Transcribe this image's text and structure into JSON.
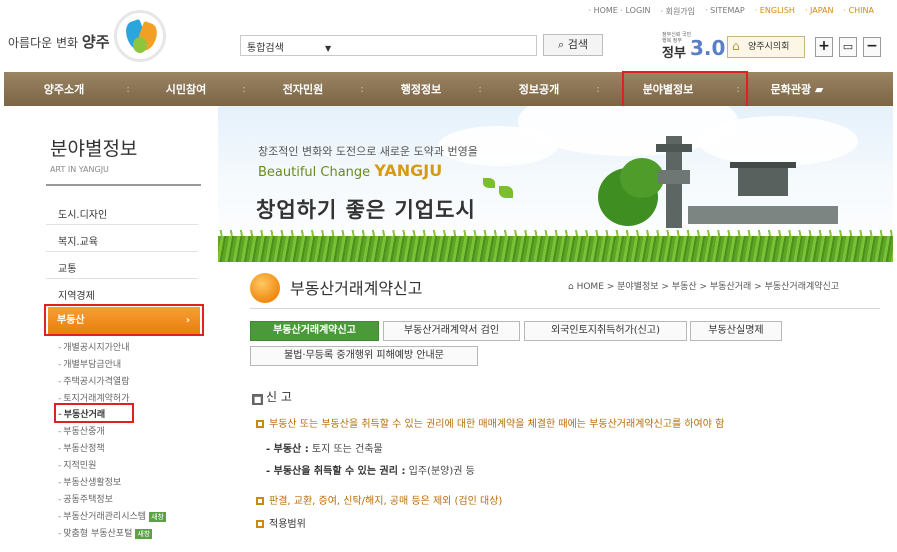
{
  "util_links": [
    "· HOME · LOGIN",
    "· 회원가입",
    "· SITEMAP",
    "· ENGLISH",
    "· JAPAN",
    "· CHINA"
  ],
  "logo": {
    "slogan": "아름다운 변화",
    "city": "양주"
  },
  "search": {
    "scope": "통합검색",
    "arrow": "▼",
    "button": "검색"
  },
  "gov": {
    "small": "정부신뢰 국민행복 정부",
    "text": "정부",
    "version": "3.0"
  },
  "council": "양주시의회",
  "zoom": {
    "plus": "+",
    "monitor": "▭",
    "minus": "−"
  },
  "nav": [
    "양주소개",
    "시민참여",
    "전자민원",
    "행정정보",
    "정보공개",
    "분야별정보",
    "문화관광"
  ],
  "nav_sep": ":",
  "sidebar": {
    "title": "분야별정보",
    "subtitle": "ART IN YANGJU",
    "items": [
      "도시.디자인",
      "복지.교육",
      "교통",
      "지역경제"
    ],
    "active": "부동산",
    "active_chevron": "›",
    "sub_items": [
      "개별공시지가안내",
      "개별부담금안내",
      "주택공시가격열람",
      "토지거래계약허가",
      "부동산거래",
      "부동산중개",
      "부동산정책",
      "지적민원",
      "부동산생활정보",
      "공동주택정보",
      "부동산거래관리시스템",
      "맞춤형 부동산포털"
    ],
    "new_tag": "새창"
  },
  "banner": {
    "line1": "창조적인 변화와 도전으로 새로운 도약과 번영을",
    "line2_prefix": "Beautiful Change",
    "line2_city": "YANGJU",
    "line3": "창업하기 좋은 기업도시"
  },
  "page": {
    "title": "부동산거래계약신고",
    "breadcrumb": "⌂ HOME > 분야별정보 > 부동산 > 부동산거래 > 부동산거래계약신고"
  },
  "tabs": [
    "부동산거래계약신고",
    "부동산거래계약서 검인",
    "외국인토지취득허가(신고)",
    "부동산실명제",
    "불법·무등록 중개행위 피해예방 안내문"
  ],
  "content": {
    "section": "신 고",
    "section_icon": "■",
    "bullet1": "부동산 또는 부동산을 취득할 수 있는 권리에 대한 매매계약을 체결한 때에는 부동산거래계약신고를 하여야 함",
    "detail1_label": "- 부동산 :",
    "detail1_value": "토지 또는 건축물",
    "detail2_label": "- 부동산을 취득할 수 있는 권리 :",
    "detail2_value": "입주(분양)권 등",
    "bullet2": "판결, 교환, 증여, 신탁/해지, 공매 등은 제외 (검인 대상)",
    "bullet3": "적용범위"
  }
}
